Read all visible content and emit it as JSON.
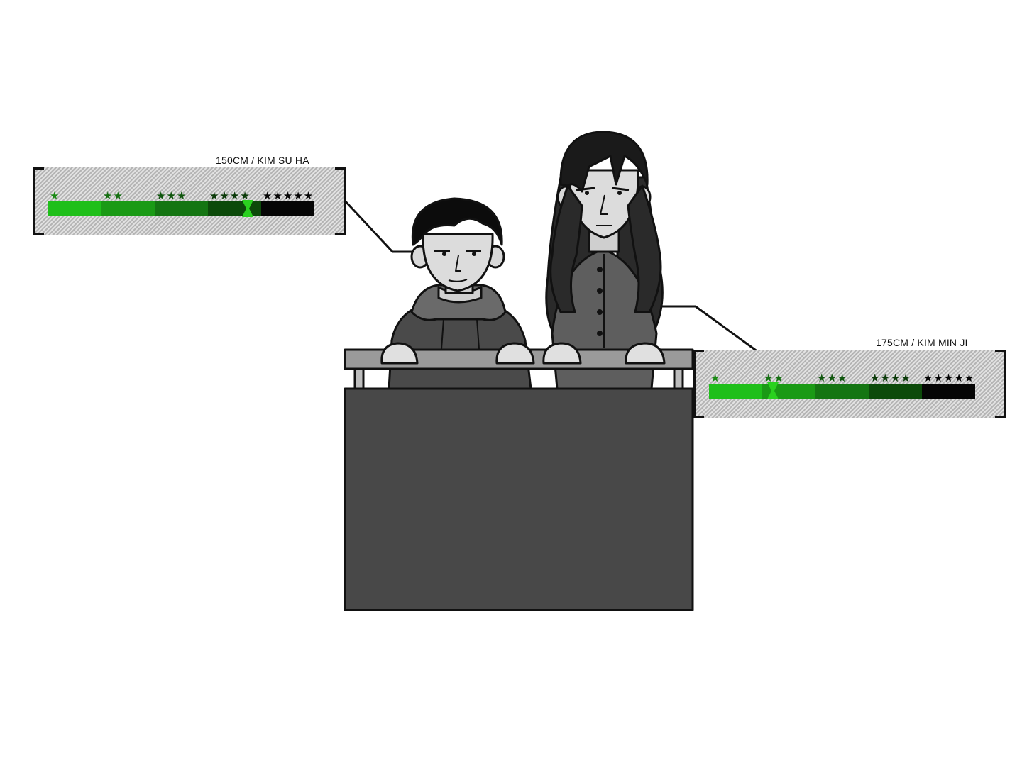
{
  "characters": [
    {
      "label": "150CM / KIM SU HA",
      "level": 0.75,
      "tiers": [
        {
          "stars": "★",
          "fill": "#1fbf1a",
          "star_color": "#1a8a14"
        },
        {
          "stars": "★★",
          "fill": "#1a9a15",
          "star_color": "#157012"
        },
        {
          "stars": "★★★",
          "fill": "#147512",
          "star_color": "#0f560d"
        },
        {
          "stars": "★★★★",
          "fill": "#0c4a0a",
          "star_color": "#0a3a08"
        },
        {
          "stars": "★★★★★",
          "fill": "#050505",
          "star_color": "#050505"
        }
      ]
    },
    {
      "label": "175CM / KIM MIN JI",
      "level": 0.24,
      "tiers": [
        {
          "stars": "★",
          "fill": "#1fbf1a",
          "star_color": "#1a8a14"
        },
        {
          "stars": "★★",
          "fill": "#1a9a15",
          "star_color": "#157012"
        },
        {
          "stars": "★★★",
          "fill": "#147512",
          "star_color": "#0f560d"
        },
        {
          "stars": "★★★★",
          "fill": "#0c4a0a",
          "star_color": "#0a3a08"
        },
        {
          "stars": "★★★★★",
          "fill": "#050505",
          "star_color": "#050505"
        }
      ]
    }
  ],
  "colors": {
    "marker": "#2ad11f",
    "desk_front": "#484848",
    "desk_top": "#9a9a9a",
    "outline": "#111111"
  }
}
